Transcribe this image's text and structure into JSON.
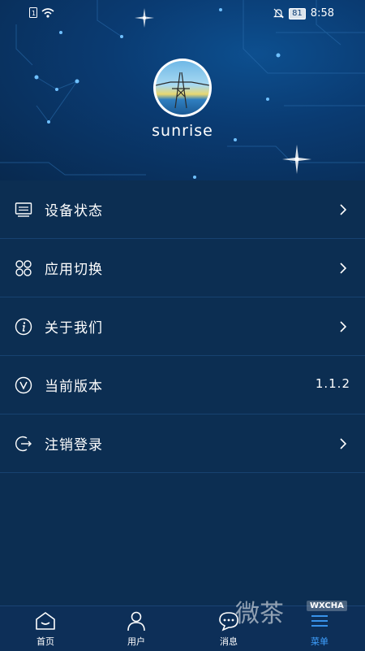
{
  "status_bar": {
    "time": "8:58",
    "battery": "81",
    "icons": [
      "sim-icon",
      "wifi-icon",
      "mute-icon",
      "battery-icon"
    ]
  },
  "profile": {
    "username": "sunrise"
  },
  "menu": {
    "items": [
      {
        "label": "设备状态",
        "icon": "device-status-icon",
        "action": "chevron"
      },
      {
        "label": "应用切换",
        "icon": "app-switch-icon",
        "action": "chevron"
      },
      {
        "label": "关于我们",
        "icon": "info-icon",
        "action": "chevron"
      },
      {
        "label": "当前版本",
        "icon": "version-icon",
        "value": "1.1.2"
      },
      {
        "label": "注销登录",
        "icon": "logout-icon",
        "action": "chevron"
      }
    ]
  },
  "tabbar": {
    "tabs": [
      {
        "label": "首页",
        "icon": "home-icon"
      },
      {
        "label": "用户",
        "icon": "user-icon"
      },
      {
        "label": "消息",
        "icon": "message-icon"
      },
      {
        "label": "菜单",
        "icon": "menu-icon",
        "active": true
      }
    ]
  },
  "watermark": {
    "text": "微茶",
    "badge": "WXCHA"
  },
  "colors": {
    "background": "#0c2e52",
    "header_bg": "#0a3b72",
    "divider": "#174270",
    "active_tab": "#3ea0ff"
  }
}
